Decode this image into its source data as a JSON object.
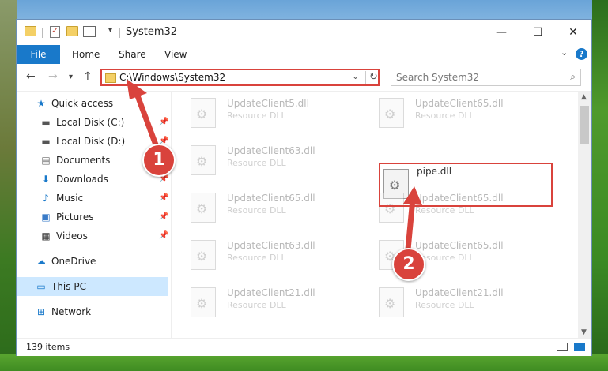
{
  "window": {
    "title": "System32",
    "controls": {
      "minimize": "—",
      "maximize": "☐",
      "close": "✕"
    }
  },
  "ribbon": {
    "tabs": [
      "File",
      "Home",
      "Share",
      "View"
    ],
    "help": "?"
  },
  "nav": {
    "address": "C:\\Windows\\System32",
    "search_placeholder": "Search System32"
  },
  "sidebar": {
    "items": [
      {
        "label": "Quick access",
        "icon": "star-icon"
      },
      {
        "label": "Local Disk (C:)",
        "icon": "drive-icon"
      },
      {
        "label": "Local Disk (D:)",
        "icon": "drive-icon"
      },
      {
        "label": "Documents",
        "icon": "documents-icon"
      },
      {
        "label": "Downloads",
        "icon": "download-icon"
      },
      {
        "label": "Music",
        "icon": "music-icon"
      },
      {
        "label": "Pictures",
        "icon": "pictures-icon"
      },
      {
        "label": "Videos",
        "icon": "videos-icon"
      },
      {
        "label": "OneDrive",
        "icon": "cloud-icon"
      },
      {
        "label": "This PC",
        "icon": "computer-icon"
      },
      {
        "label": "Network",
        "icon": "network-icon"
      }
    ]
  },
  "files": [
    {
      "name": "UpdateClient5.dll",
      "type": "Resource DLL"
    },
    {
      "name": "UpdateClient65.dll",
      "type": "Resource DLL"
    },
    {
      "name": "UpdateClient63.dll",
      "type": "Resource DLL"
    },
    {
      "name": "pipe.dll",
      "type": ""
    },
    {
      "name": "UpdateClient65.dll",
      "type": "Resource DLL"
    },
    {
      "name": "UpdateClient65.dll",
      "type": "Resource DLL"
    },
    {
      "name": "UpdateClient63.dll",
      "type": "Resource DLL"
    },
    {
      "name": "UpdateClient65.dll",
      "type": "Resource DLL"
    },
    {
      "name": "UpdateClient21.dll",
      "type": "Resource DLL"
    },
    {
      "name": "UpdateClient21.dll",
      "type": "Resource DLL"
    }
  ],
  "status": {
    "item_count": "139 items"
  },
  "annotations": {
    "step1": "1",
    "step2": "2"
  },
  "colors": {
    "accent": "#1979ca",
    "highlight": "#d9433c",
    "selected": "#cde8ff"
  }
}
